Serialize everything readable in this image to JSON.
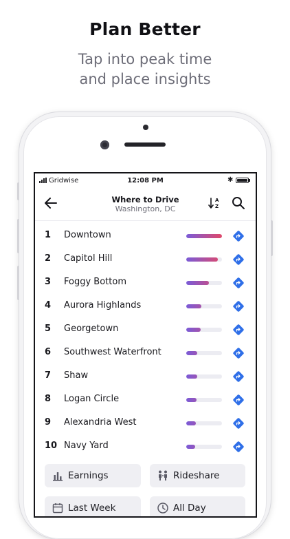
{
  "promo": {
    "headline": "Plan Better",
    "subline_1": "Tap into peak time",
    "subline_2": "and place insights"
  },
  "status_bar": {
    "carrier": "Gridwise",
    "time": "12:08 PM",
    "bluetooth_icon": "bluetooth-icon",
    "battery_icon": "battery-icon"
  },
  "nav": {
    "title": "Where to Drive",
    "subtitle": "Washington, DC",
    "back_icon": "arrow-left-icon",
    "sort_icon": "sort-a-z-icon",
    "search_icon": "search-icon"
  },
  "colors": {
    "bar_start": "#7a5bd8",
    "bar_end": "#e0486a",
    "bar_track": "#ececf2",
    "direction_blue": "#2f6fe8",
    "chip_background": "#efeff3"
  },
  "places": [
    {
      "rank": "1",
      "name": "Downtown",
      "level": 1.0
    },
    {
      "rank": "2",
      "name": "Capitol Hill",
      "level": 0.88
    },
    {
      "rank": "3",
      "name": "Foggy Bottom",
      "level": 0.63
    },
    {
      "rank": "4",
      "name": "Aurora Highlands",
      "level": 0.42
    },
    {
      "rank": "5",
      "name": "Georgetown",
      "level": 0.4
    },
    {
      "rank": "6",
      "name": "Southwest Waterfront",
      "level": 0.31
    },
    {
      "rank": "7",
      "name": "Shaw",
      "level": 0.31
    },
    {
      "rank": "8",
      "name": "Logan Circle",
      "level": 0.29
    },
    {
      "rank": "9",
      "name": "Alexandria West",
      "level": 0.27
    },
    {
      "rank": "10",
      "name": "Navy Yard",
      "level": 0.25
    }
  ],
  "filters": {
    "metric": {
      "label": "Earnings",
      "icon": "bar-chart-icon"
    },
    "service": {
      "label": "Rideshare",
      "icon": "rideshare-icon"
    },
    "period": {
      "label": "Last Week",
      "icon": "calendar-icon"
    },
    "time_of_day": {
      "label": "All Day",
      "icon": "clock-icon"
    }
  }
}
